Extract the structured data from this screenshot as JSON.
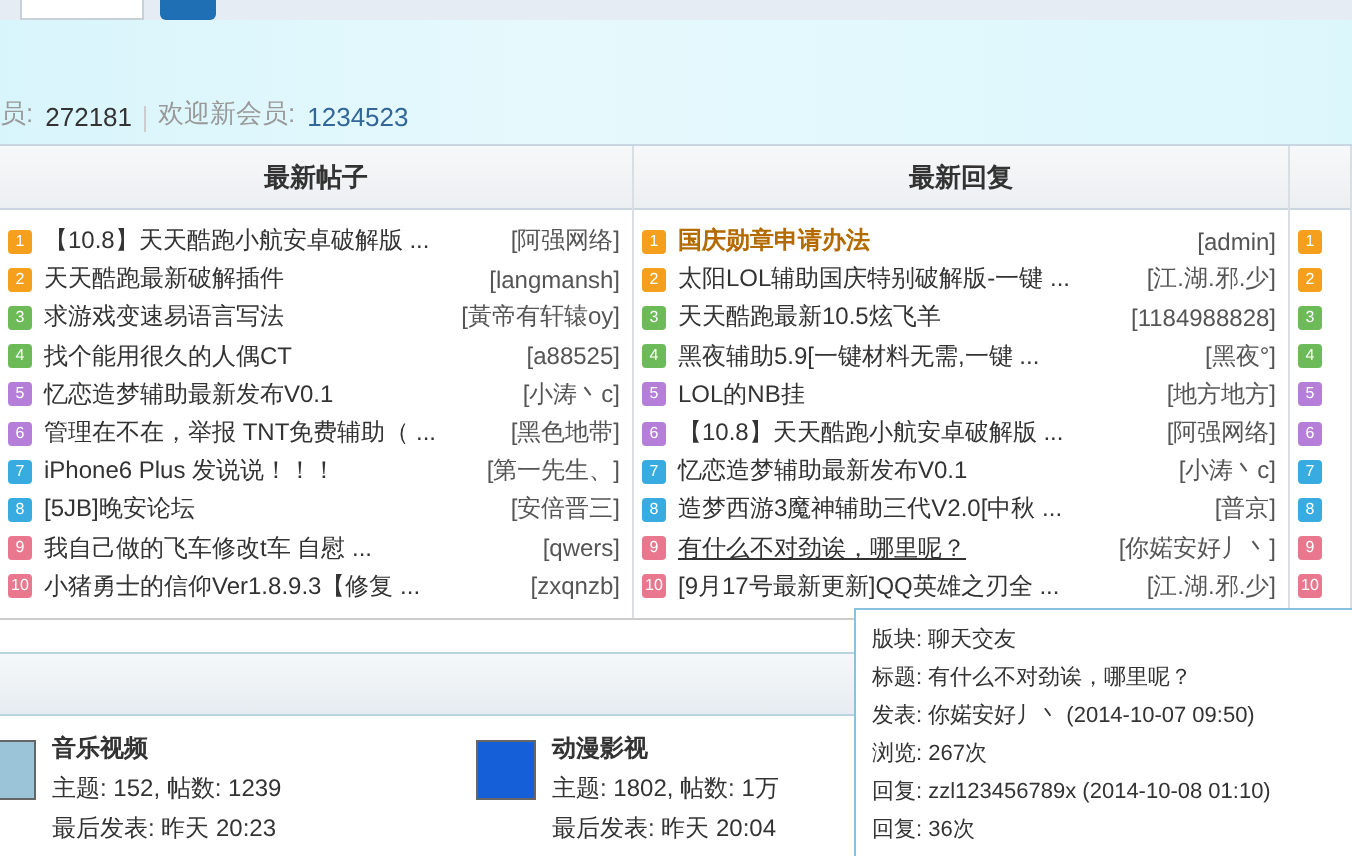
{
  "stats": {
    "members_label": "员:",
    "members": "272181",
    "new_member_label": "欢迎新会员:",
    "new_member": "1234523"
  },
  "columns": [
    {
      "title": "最新帖子",
      "posts": [
        {
          "rank": "1",
          "title": "【10.8】天天酷跑小航安卓破解版 ...",
          "author": "[阿强网络]",
          "kind": "normal"
        },
        {
          "rank": "2",
          "title": "天天酷跑最新破解插件",
          "author": "[langmansh]",
          "kind": "normal"
        },
        {
          "rank": "3",
          "title": "求游戏变速易语言写法",
          "author": "[黃帝有轩辕oy]",
          "kind": "normal"
        },
        {
          "rank": "4",
          "title": "找个能用很久的人偶CT",
          "author": "[a88525]",
          "kind": "normal"
        },
        {
          "rank": "5",
          "title": "忆恋造梦辅助最新发布V0.1",
          "author": "[小涛丶c]",
          "kind": "normal"
        },
        {
          "rank": "6",
          "title": "管理在不在，举报 TNT免费辅助（ ...",
          "author": "[黑色地带]",
          "kind": "normal"
        },
        {
          "rank": "7",
          "title": "iPhone6 Plus 发说说！！！",
          "author": "[第一先生、]",
          "kind": "normal"
        },
        {
          "rank": "8",
          "title": "[5JB]晚安论坛",
          "author": "[安倍晋三]",
          "kind": "normal"
        },
        {
          "rank": "9",
          "title": "我自己做的飞车修改t车 自慰 ...",
          "author": "[qwers]",
          "kind": "normal"
        },
        {
          "rank": "10",
          "title": "小猪勇士的信仰Ver1.8.9.3【修复 ...",
          "author": "[zxqnzb]",
          "kind": "normal"
        }
      ]
    },
    {
      "title": "最新回复",
      "posts": [
        {
          "rank": "1",
          "title": "国庆勋章申请办法",
          "author": "[admin]",
          "kind": "highlight"
        },
        {
          "rank": "2",
          "title": "太阳LOL辅助国庆特别破解版-一键 ...",
          "author": "[江.湖.邪.少]",
          "kind": "normal"
        },
        {
          "rank": "3",
          "title": "天天酷跑最新10.5炫飞羊",
          "author": "[1184988828]",
          "kind": "normal"
        },
        {
          "rank": "4",
          "title": "黑夜辅助5.9[一键材料无需,一键 ...",
          "author": "[黑夜°]",
          "kind": "normal"
        },
        {
          "rank": "5",
          "title": "LOL的NB挂",
          "author": "[地方地方]",
          "kind": "normal"
        },
        {
          "rank": "6",
          "title": "【10.8】天天酷跑小航安卓破解版 ...",
          "author": "[阿强网络]",
          "kind": "normal"
        },
        {
          "rank": "7",
          "title": "忆恋造梦辅助最新发布V0.1",
          "author": "[小涛丶c]",
          "kind": "normal"
        },
        {
          "rank": "8",
          "title": "造梦西游3魔神辅助三代V2.0[中秋 ...",
          "author": "[普京]",
          "kind": "normal"
        },
        {
          "rank": "9",
          "title": "有什么不对劲诶，哪里呢？",
          "author": "[你婼安好丿丶]",
          "kind": "hover"
        },
        {
          "rank": "10",
          "title": "[9月17号最新更新]QQ英雄之刃全 ...",
          "author": "[江.湖.邪.少]",
          "kind": "normal"
        }
      ]
    },
    {
      "posts": [
        {
          "rank": "1"
        },
        {
          "rank": "2"
        },
        {
          "rank": "3"
        },
        {
          "rank": "4"
        },
        {
          "rank": "5"
        },
        {
          "rank": "6"
        },
        {
          "rank": "7"
        },
        {
          "rank": "8"
        },
        {
          "rank": "9"
        },
        {
          "rank": "10"
        }
      ]
    }
  ],
  "forums": [
    {
      "name": "音乐视频",
      "stats": "主题: 152, 帖数: 1239",
      "last_post": "最后发表: 昨天 20:23"
    },
    {
      "name": "动漫影视",
      "stats": "主题: 1802, 帖数: 1万",
      "last_post": "最后发表: 昨天 20:04"
    }
  ],
  "tooltip": {
    "lines": [
      "版块: 聊天交友",
      "标题: 有什么不对劲诶，哪里呢？",
      "发表: 你婼安好丿丶 (2014-10-07 09:50)",
      "浏览: 267次",
      "回复: zzl123456789x (2014-10-08 01:10)",
      "回复: 36次"
    ]
  }
}
